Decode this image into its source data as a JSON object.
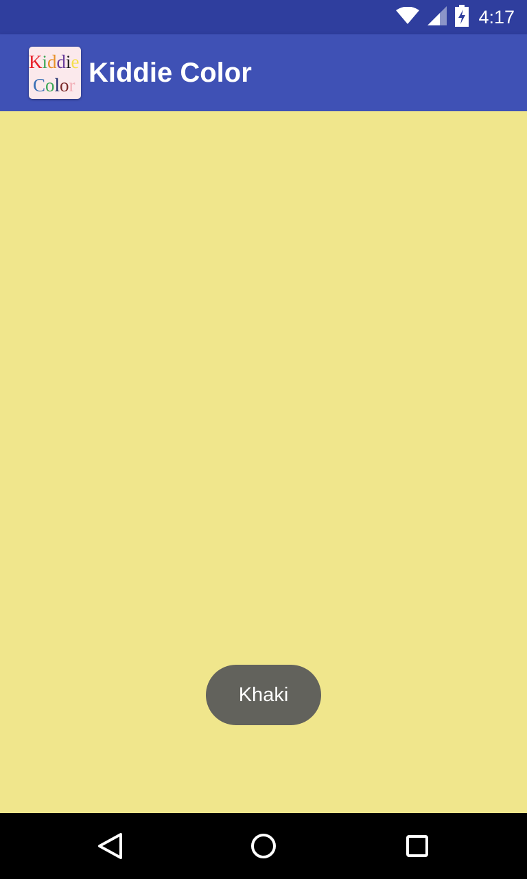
{
  "status_bar": {
    "time": "4:17",
    "icons": [
      "wifi-icon",
      "cell-signal-icon",
      "battery-charging-icon"
    ],
    "color": "#2f3e9e"
  },
  "app_bar": {
    "title": "Kiddie Color",
    "logo": {
      "line1": [
        "K",
        "i",
        "d",
        "d",
        "i",
        "e"
      ],
      "line2": [
        "C",
        "o",
        "l",
        "o",
        "r"
      ],
      "line1_colors": [
        "#e8202a",
        "#3aa655",
        "#e8902a",
        "#6a3d9a",
        "#222222",
        "#f5e04a"
      ],
      "line2_colors": [
        "#3a6fb5",
        "#3aa655",
        "#1a2a6a",
        "#7a2a2a",
        "#f2b0b8"
      ]
    },
    "color": "#3f51b5"
  },
  "content": {
    "background_color_name": "Khaki",
    "background_color": "#f0e68c"
  },
  "toast": {
    "text": "Khaki",
    "color": "#62625c"
  },
  "nav_bar": {
    "buttons": [
      "back-icon",
      "home-icon",
      "recents-icon"
    ]
  }
}
